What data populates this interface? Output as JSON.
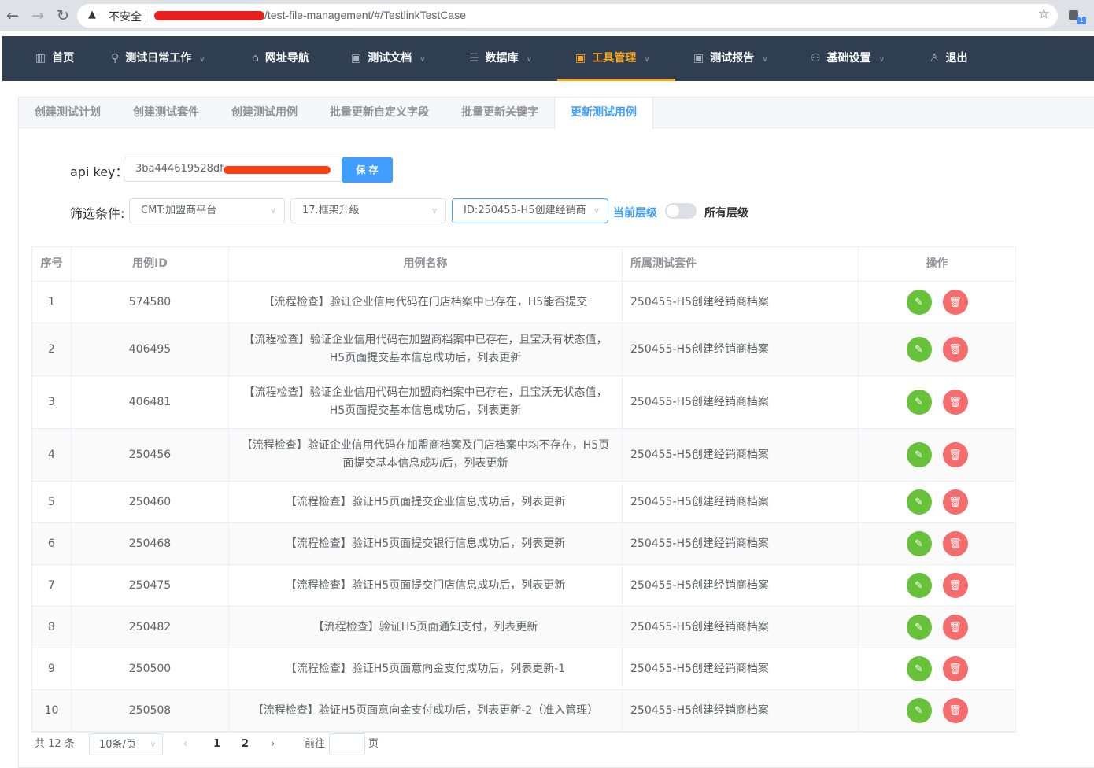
{
  "browser": {
    "insecure_label": "不安全",
    "url_path": "/test-file-management/#/TestlinkTestCase",
    "ext_badge": "1"
  },
  "nav": {
    "items": [
      {
        "label": "首页",
        "icon": "bar-chart-icon"
      },
      {
        "label": "测试日常工作",
        "icon": "run-icon"
      },
      {
        "label": "网址导航",
        "icon": "bank-icon"
      },
      {
        "label": "测试文档",
        "icon": "doc-icon"
      },
      {
        "label": "数据库",
        "icon": "database-icon"
      },
      {
        "label": "工具管理",
        "icon": "doc-icon"
      },
      {
        "label": "测试报告",
        "icon": "doc-icon"
      },
      {
        "label": "基础设置",
        "icon": "person-board-icon"
      },
      {
        "label": "退出",
        "icon": "user-icon"
      }
    ],
    "active": "工具管理",
    "active_color": "#f5a623",
    "bg_color": "#2f3e50"
  },
  "tabs": [
    "创建测试计划",
    "创建测试套件",
    "创建测试用例",
    "批量更新自定义字段",
    "批量更新关键字",
    "更新测试用例"
  ],
  "active_tab": "更新测试用例",
  "form": {
    "apikey_label": "api key：",
    "apikey_value": "3ba444619528df",
    "save_label": "保 存",
    "filter_label": "筛选条件:",
    "select1": "CMT:加盟商平台",
    "select2": "17.框架升级",
    "select3": "ID:250455-H5创建经销商",
    "current_level": "当前层级",
    "all_levels": "所有层级"
  },
  "table": {
    "headers": [
      "序号",
      "用例ID",
      "用例名称",
      "所属测试套件",
      "操作"
    ],
    "rows": [
      {
        "no": "1",
        "id": "574580",
        "name": "【流程检查】验证企业信用代码在门店档案中已存在，H5能否提交",
        "suite": "250455-H5创建经销商档案"
      },
      {
        "no": "2",
        "id": "406495",
        "name": "【流程检查】验证企业信用代码在加盟商档案中已存在，且宝沃有状态值，H5页面提交基本信息成功后，列表更新",
        "suite": "250455-H5创建经销商档案"
      },
      {
        "no": "3",
        "id": "406481",
        "name": "【流程检查】验证企业信用代码在加盟商档案中已存在，且宝沃无状态值，H5页面提交基本信息成功后，列表更新",
        "suite": "250455-H5创建经销商档案"
      },
      {
        "no": "4",
        "id": "250456",
        "name": "【流程检查】验证企业信用代码在加盟商档案及门店档案中均不存在，H5页面提交基本信息成功后，列表更新",
        "suite": "250455-H5创建经销商档案"
      },
      {
        "no": "5",
        "id": "250460",
        "name": "【流程检查】验证H5页面提交企业信息成功后，列表更新",
        "suite": "250455-H5创建经销商档案"
      },
      {
        "no": "6",
        "id": "250468",
        "name": "【流程检查】验证H5页面提交银行信息成功后，列表更新",
        "suite": "250455-H5创建经销商档案"
      },
      {
        "no": "7",
        "id": "250475",
        "name": "【流程检查】验证H5页面提交门店信息成功后，列表更新",
        "suite": "250455-H5创建经销商档案"
      },
      {
        "no": "8",
        "id": "250482",
        "name": "【流程检查】验证H5页面通知支付，列表更新",
        "suite": "250455-H5创建经销商档案"
      },
      {
        "no": "9",
        "id": "250500",
        "name": "【流程检查】验证H5页面意向金支付成功后，列表更新-1",
        "suite": "250455-H5创建经销商档案"
      },
      {
        "no": "10",
        "id": "250508",
        "name": "【流程检查】验证H5页面意向金支付成功后，列表更新-2（准入管理）",
        "suite": "250455-H5创建经销商档案"
      }
    ]
  },
  "pager": {
    "total": "共 12 条",
    "page_size": "10条/页",
    "pages": [
      "1",
      "2"
    ],
    "goto_label": "前往",
    "page_suffix": "页"
  }
}
